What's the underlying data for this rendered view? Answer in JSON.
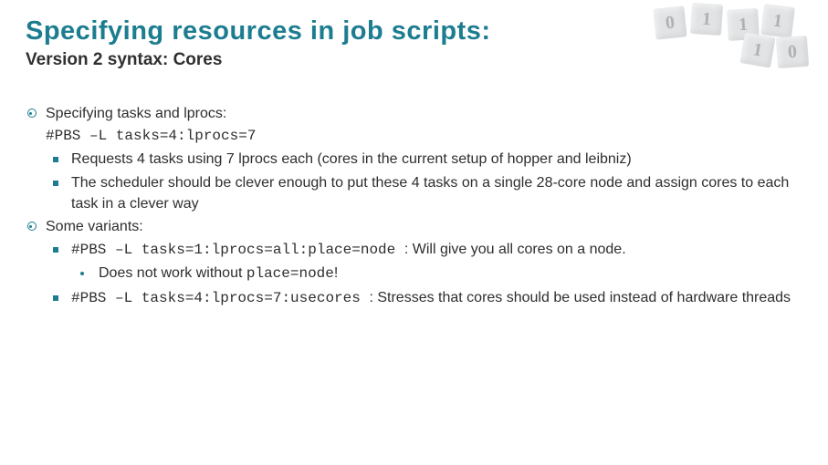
{
  "title": "Specifying resources in job scripts:",
  "subtitle": "Version 2 syntax: Cores",
  "b1": {
    "head": "Specifying tasks and lprocs:",
    "code": "#PBS –L tasks=4:lprocs=7",
    "s1": "Requests 4 tasks using 7 lprocs each (cores in the current setup of hopper and leibniz)",
    "s2": "The scheduler should be clever enough to put these 4 tasks on a single 28-core node and assign cores to each task in a clever way"
  },
  "b2": {
    "head": "Some variants:",
    "s1": {
      "code": "#PBS –L tasks=1:lprocs=all:place=node ",
      "rest": ": Will give you all cores on a node.",
      "note_a": "Does not work without ",
      "note_b": "place=node",
      "note_c": "!"
    },
    "s2": {
      "code": "#PBS –L tasks=4:lprocs=7:usecores ",
      "rest": ": Stresses that cores should be used instead of hardware threads"
    }
  },
  "deco": {
    "d1": "0",
    "d2": "1",
    "d3": "1",
    "d4": "1",
    "d5": "1",
    "d6": "0"
  }
}
